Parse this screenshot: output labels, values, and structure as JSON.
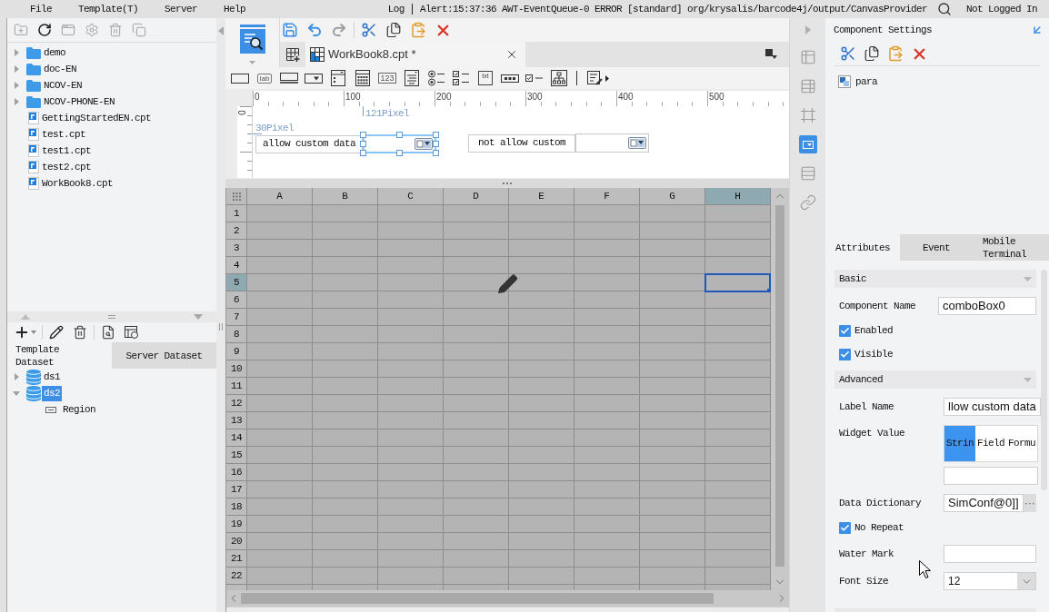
{
  "menu_bar": {
    "items": [
      "File",
      "Template(T)",
      "Server",
      "Help"
    ],
    "log": "Log",
    "alert": "Alert:15:37:36 AWT-EventQueue-0 ERROR [standard] org/krysalis/barcode4j/output/CanvasProvider",
    "account": "Not Logged In"
  },
  "template_tree": [
    {
      "label": "demo",
      "kind": "folder",
      "expanded": false
    },
    {
      "label": "doc-EN",
      "kind": "folder",
      "expanded": false
    },
    {
      "label": "NCOV-EN",
      "kind": "folder",
      "expanded": false
    },
    {
      "label": "NCOV-PHONE-EN",
      "kind": "folder",
      "expanded": false
    },
    {
      "label": "GettingStartedEN.cpt",
      "kind": "file"
    },
    {
      "label": "test.cpt",
      "kind": "file"
    },
    {
      "label": "test1.cpt",
      "kind": "file"
    },
    {
      "label": "test2.cpt",
      "kind": "file"
    },
    {
      "label": "WorkBook8.cpt",
      "kind": "file"
    }
  ],
  "dataset_panel": {
    "tabs": [
      {
        "label": "Template Dataset",
        "selected": true
      },
      {
        "label": "Server Dataset",
        "selected": false
      }
    ],
    "datasets": [
      {
        "label": "ds1",
        "expanded": false,
        "selected": false
      },
      {
        "label": "ds2",
        "expanded": true,
        "selected": true,
        "children": [
          {
            "label": "Region",
            "selected": false
          }
        ]
      }
    ]
  },
  "editor": {
    "tabs": [
      {
        "label": "WorkBook8.cpt *",
        "selected": true
      }
    ],
    "widget_toolbar": [
      {
        "kind": "button"
      },
      {
        "kind": "label",
        "glyph": "lab"
      },
      {
        "kind": "textfield"
      },
      {
        "kind": "combo"
      },
      {
        "kind": "list"
      },
      {
        "kind": "date"
      },
      {
        "kind": "number",
        "glyph": "123"
      },
      {
        "kind": "textarea"
      },
      {
        "kind": "radio"
      },
      {
        "kind": "checkgroup"
      },
      {
        "kind": "text",
        "glyph": "txt"
      },
      {
        "kind": "password"
      },
      {
        "kind": "checkbox"
      },
      {
        "kind": "tree"
      }
    ],
    "ruler": {
      "horizontal": [
        "0",
        "100",
        "200",
        "300",
        "400",
        "500"
      ],
      "vertical": [
        "0"
      ]
    },
    "form_canvas": {
      "width_label": "121Pixel",
      "height_label": "30Pixel",
      "widgets": [
        {
          "label": "allow custom data",
          "selected": true
        },
        {
          "label": "not allow custom",
          "selected": false
        }
      ]
    },
    "sheet": {
      "columns": [
        {
          "label": "A",
          "selected": false
        },
        {
          "label": "B",
          "selected": false
        },
        {
          "label": "C",
          "selected": false
        },
        {
          "label": "D",
          "selected": false
        },
        {
          "label": "E",
          "selected": false
        },
        {
          "label": "F",
          "selected": false
        },
        {
          "label": "G",
          "selected": false
        },
        {
          "label": "H",
          "selected": true
        }
      ],
      "rows": [
        {
          "label": "1",
          "selected": false
        },
        {
          "label": "2",
          "selected": false
        },
        {
          "label": "3",
          "selected": false
        },
        {
          "label": "4",
          "selected": false
        },
        {
          "label": "5",
          "selected": true
        },
        {
          "label": "6",
          "selected": false
        },
        {
          "label": "7",
          "selected": false
        },
        {
          "label": "8",
          "selected": false
        },
        {
          "label": "9",
          "selected": false
        },
        {
          "label": "10",
          "selected": false
        },
        {
          "label": "11",
          "selected": false
        },
        {
          "label": "12",
          "selected": false
        },
        {
          "label": "13",
          "selected": false
        },
        {
          "label": "14",
          "selected": false
        },
        {
          "label": "15",
          "selected": false
        },
        {
          "label": "16",
          "selected": false
        },
        {
          "label": "17",
          "selected": false
        },
        {
          "label": "18",
          "selected": false
        },
        {
          "label": "19",
          "selected": false
        },
        {
          "label": "20",
          "selected": false
        },
        {
          "label": "21",
          "selected": false
        },
        {
          "label": "22",
          "selected": false
        }
      ]
    }
  },
  "side_rail": [
    {
      "selected": false
    },
    {
      "selected": false
    },
    {
      "selected": false
    },
    {
      "selected": true
    },
    {
      "selected": false
    },
    {
      "selected": false
    }
  ],
  "component_settings": {
    "title": "Component Settings",
    "tree": [
      {
        "label": "para"
      }
    ]
  },
  "properties": {
    "tabs": [
      {
        "label": "Attributes",
        "selected": true
      },
      {
        "label": "Event",
        "selected": false
      },
      {
        "label": "Mobile Terminal",
        "selected": false
      }
    ],
    "sections": [
      {
        "title": "Basic",
        "expanded": true,
        "rows": [
          {
            "kind": "text",
            "label": "Component Name",
            "value": "comboBox0"
          },
          {
            "kind": "checkbox",
            "label": "Enabled",
            "checked": true
          },
          {
            "kind": "checkbox",
            "label": "Visible",
            "checked": true
          }
        ]
      },
      {
        "title": "Advanced",
        "expanded": true,
        "rows": [
          {
            "kind": "text",
            "label": "Label Name",
            "value": "llow custom data"
          },
          {
            "kind": "segmented",
            "label": "Widget Value",
            "options": [
              {
                "label": "Strin",
                "selected": true
              },
              {
                "label": "Field",
                "selected": false
              },
              {
                "label": "Formu",
                "selected": false
              }
            ]
          },
          {
            "kind": "picker",
            "label": "Data Dictionary",
            "value": "SimConf@0]]",
            "button": "···"
          },
          {
            "kind": "checkbox",
            "label": "No Repeat",
            "checked": true
          },
          {
            "kind": "text",
            "label": "Water Mark"
          },
          {
            "kind": "select",
            "label": "Font Size",
            "value": "12"
          }
        ]
      }
    ]
  }
}
